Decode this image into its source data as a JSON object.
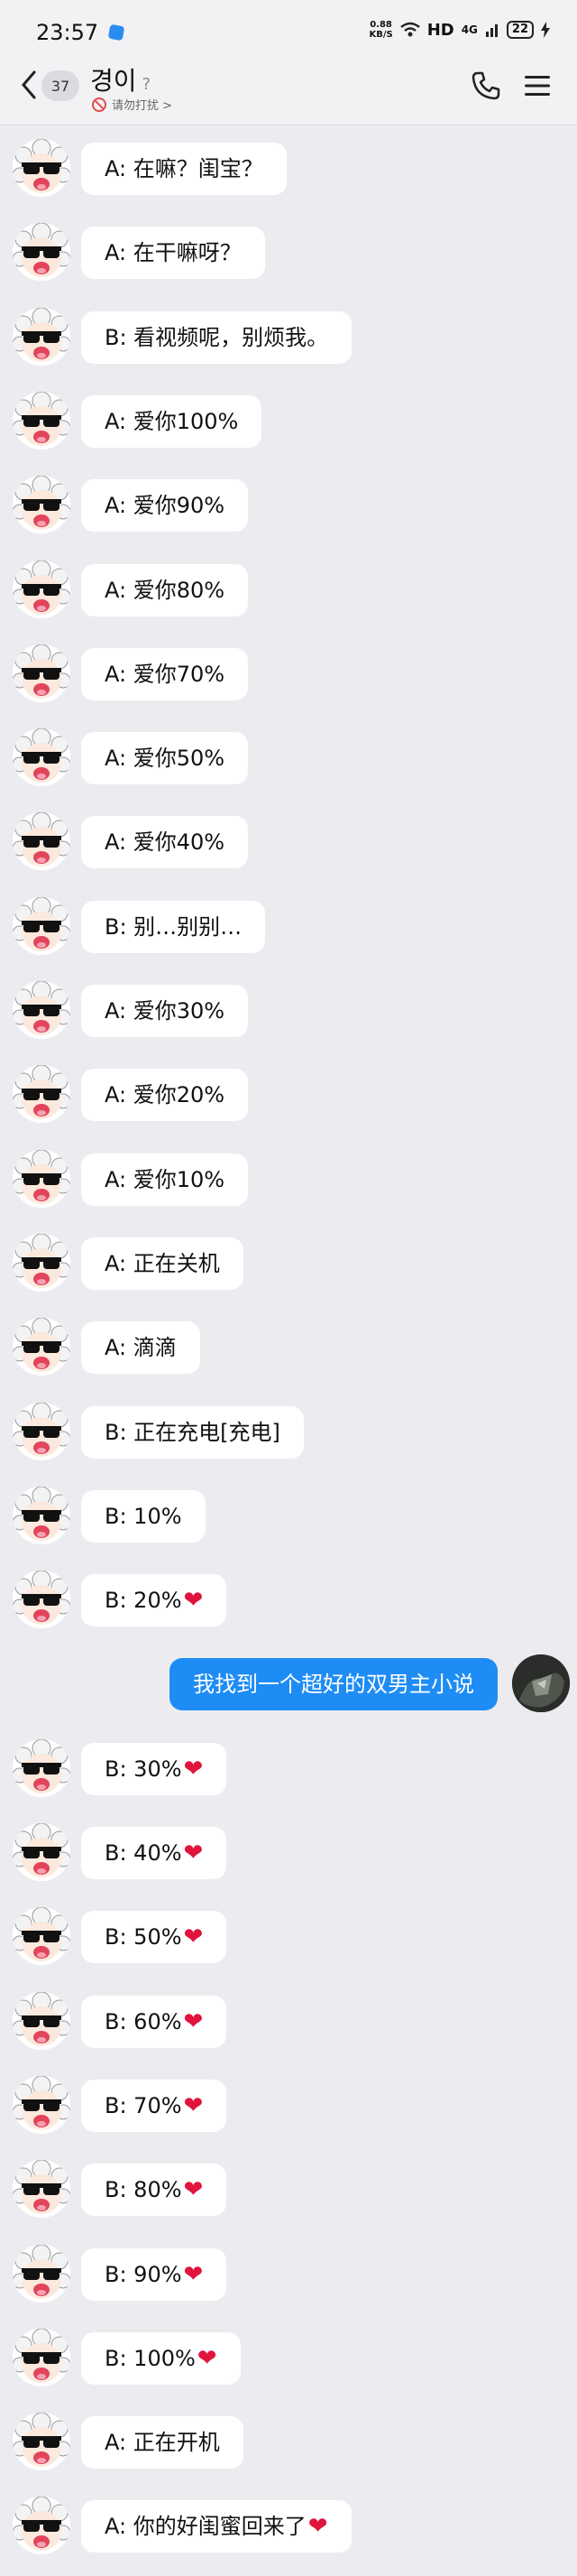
{
  "status_bar": {
    "time": "23:57",
    "net_speed_value": "0.88",
    "net_speed_unit": "KB/S",
    "hd": "HD",
    "signal": "4G",
    "battery": "22"
  },
  "header": {
    "unread_count": "37",
    "title": "경이",
    "help_glyph": "?",
    "subtitle": "请勿打扰 >"
  },
  "messages": [
    {
      "text": "A: 在嘛？闺宝？"
    },
    {
      "text": "A: 在干嘛呀？"
    },
    {
      "text": "B: 看视频呢，别烦我。"
    },
    {
      "text": "A: 爱你100%"
    },
    {
      "text": "A: 爱你90%"
    },
    {
      "text": "A: 爱你80%"
    },
    {
      "text": "A: 爱你70%"
    },
    {
      "text": "A: 爱你50%"
    },
    {
      "text": "A: 爱你40%"
    },
    {
      "text": "B: 别…别别…"
    },
    {
      "text": "A: 爱你30%"
    },
    {
      "text": "A: 爱你20%"
    },
    {
      "text": "A: 爱你10%"
    },
    {
      "text": "A: 正在关机"
    },
    {
      "text": "A: 滴滴"
    },
    {
      "text": "B: 正在充电[充电]"
    },
    {
      "text": "B: 10%"
    },
    {
      "text": "B: 20%",
      "heart": "❤"
    },
    {
      "text": "我找到一个超好的双男主小说"
    },
    {
      "text": "B: 30%",
      "heart": "❤"
    },
    {
      "text": "B: 40%",
      "heart": "❤"
    },
    {
      "text": "B: 50%",
      "heart": "❤"
    },
    {
      "text": "B: 60%",
      "heart": "❤"
    },
    {
      "text": "B: 70%",
      "heart": "❤"
    },
    {
      "text": "B: 80%",
      "heart": "❤"
    },
    {
      "text": "B: 90%",
      "heart": "❤"
    },
    {
      "text": "B: 100%",
      "heart": "❤"
    },
    {
      "text": "A: 正在开机"
    },
    {
      "text": "A: 你的好闺蜜回来了",
      "heart": "❤"
    }
  ],
  "colors": {
    "background": "#ececf0",
    "incoming_bubble": "#ffffff",
    "outgoing_bubble": "#1e8cf5",
    "heart": "#e0143c"
  }
}
